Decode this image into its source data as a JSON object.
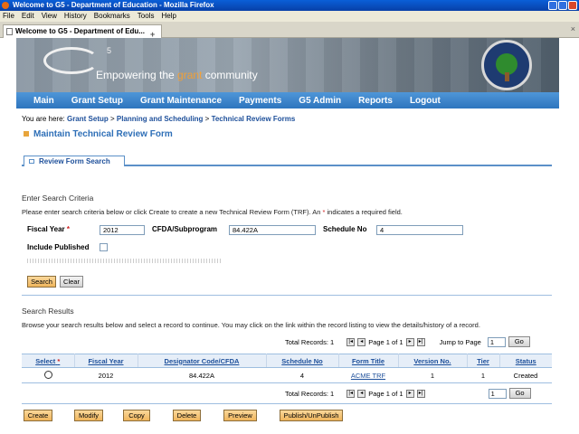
{
  "window": {
    "title": "Welcome to G5 - Department of Education - Mozilla Firefox"
  },
  "menu": [
    "File",
    "Edit",
    "View",
    "History",
    "Bookmarks",
    "Tools",
    "Help"
  ],
  "tab": {
    "title": "Welcome to G5 - Department of Edu...",
    "new_tab_glyph": "+",
    "close_glyph": "×"
  },
  "banner": {
    "logo_text": "G",
    "logo_sup": "5",
    "tagline_pre": "Empowering the ",
    "tagline_accent": "grant",
    "tagline_post": " community"
  },
  "nav": [
    "Main",
    "Grant Setup",
    "Grant Maintenance",
    "Payments",
    "G5 Admin",
    "Reports",
    "Logout"
  ],
  "breadcrumb": {
    "prefix": "You are here: ",
    "items": [
      "Grant Setup",
      "Planning and Scheduling",
      "Technical Review Forms"
    ],
    "sep": " > "
  },
  "page_title": "Maintain Technical Review Form",
  "subtab": "Review Form Search",
  "criteria": {
    "heading": "Enter Search Criteria",
    "instr_a": "Please enter search criteria below or click Create to create a new Technical Review Form (TRF). An ",
    "instr_star": "*",
    "instr_b": " indicates a required field.",
    "fiscal_year_label": "Fiscal Year",
    "fiscal_year_value": "2012",
    "cfda_label": "CFDA/Subprogram",
    "cfda_value": "84.422A",
    "schedule_label": "Schedule No",
    "schedule_value": "4",
    "include_published_label": "Include Published",
    "include_published_checked": false,
    "search_button": "Search",
    "clear_button": "Clear"
  },
  "results": {
    "heading": "Search Results",
    "instructions": "Browse your search results below and select a record to continue. You may click on the link within the record listing to view the details/history of a record.",
    "total_label": "Total Records: 1",
    "page_label": "Page 1 of 1",
    "jump_label": "Jump to Page",
    "jump_value": "1",
    "go_button": "Go",
    "columns": [
      "Select",
      "Fiscal Year",
      "Designator Code/CFDA",
      "Schedule No",
      "Form Title",
      "Version No.",
      "Tier",
      "Status"
    ],
    "rows": [
      {
        "fiscal_year": "2012",
        "cfda": "84.422A",
        "schedule": "4",
        "form_title": "ACME TRF",
        "version": "1",
        "tier": "1",
        "status": "Created"
      }
    ]
  },
  "actions": [
    "Create",
    "Modify",
    "Copy",
    "Delete",
    "Preview",
    "Publish/UnPublish"
  ],
  "colors": {
    "nav_blue": "#2e75be",
    "link_blue": "#1d4f9a",
    "button_orange": "#f0b55c",
    "required_red": "#d02020"
  }
}
